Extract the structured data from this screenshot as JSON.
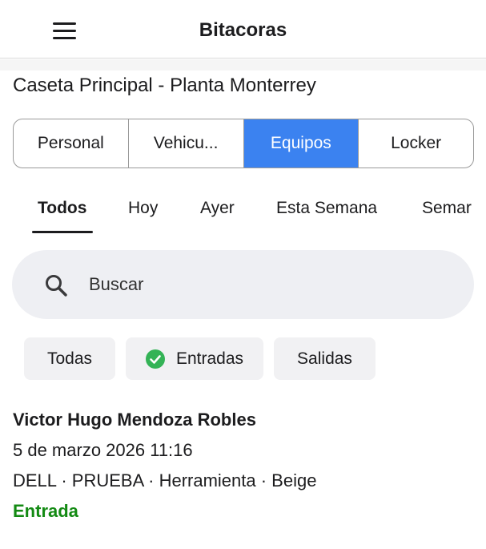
{
  "header": {
    "title": "Bitacoras",
    "menu_icon": "hamburger-menu-icon"
  },
  "location": "Caseta Principal - Planta Monterrey",
  "segments": [
    {
      "label": "Personal",
      "active": false
    },
    {
      "label": "Vehicu...",
      "active": false
    },
    {
      "label": "Equipos",
      "active": true
    },
    {
      "label": "Locker",
      "active": false
    }
  ],
  "date_tabs": [
    {
      "label": "Todos",
      "active": true
    },
    {
      "label": "Hoy",
      "active": false
    },
    {
      "label": "Ayer",
      "active": false
    },
    {
      "label": "Esta Semana",
      "active": false
    },
    {
      "label": "Semar",
      "active": false
    }
  ],
  "search": {
    "placeholder": "Buscar",
    "icon": "search-icon"
  },
  "filters": [
    {
      "label": "Todas",
      "selected": false
    },
    {
      "label": "Entradas",
      "selected": true
    },
    {
      "label": "Salidas",
      "selected": false
    }
  ],
  "entries": [
    {
      "name": "Victor Hugo Mendoza Robles",
      "datetime": "5 de marzo 2026 11:16",
      "details": "DELL · PRUEBA · Herramienta · Beige",
      "type": "Entrada"
    }
  ],
  "colors": {
    "accent": "#3b82f0",
    "entry_green": "#138a13",
    "check_green": "#34b356",
    "search_bg": "#eeeff3",
    "chip_bg": "#f1f1f3"
  }
}
